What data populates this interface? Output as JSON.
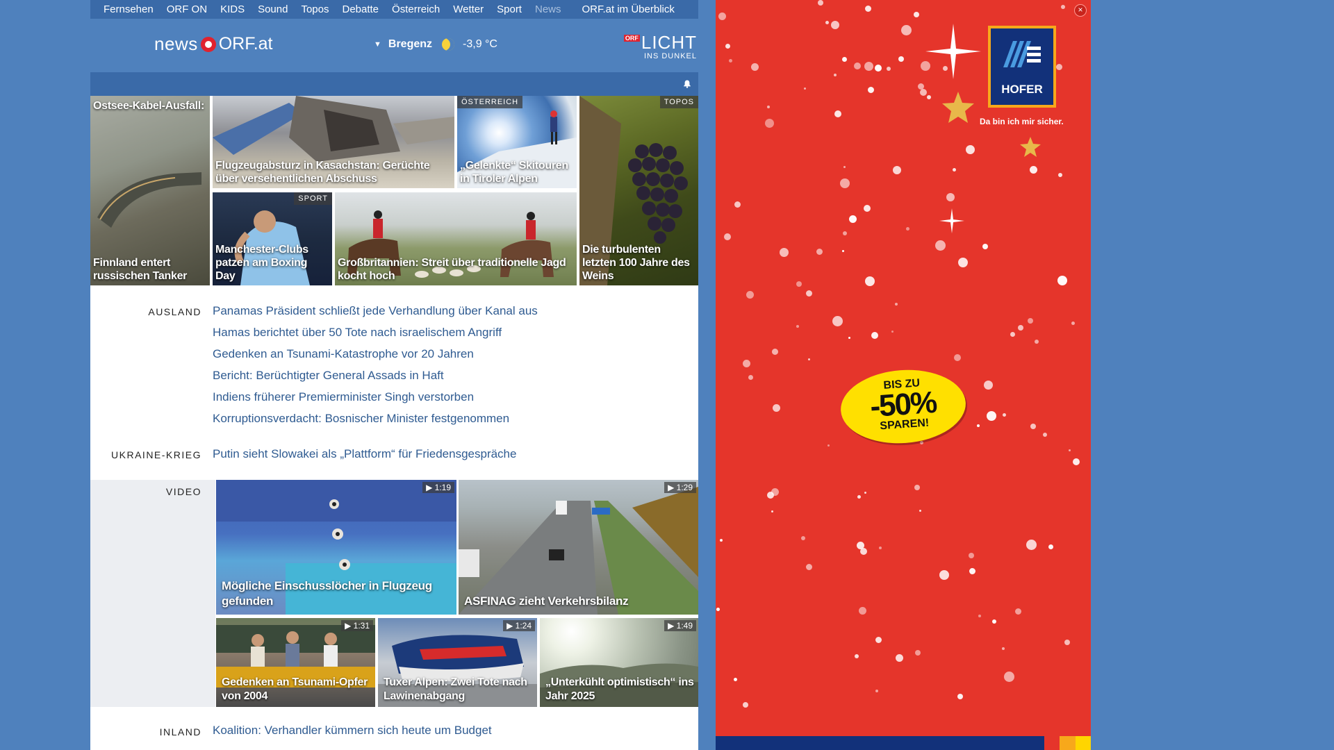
{
  "nav": {
    "items": [
      "Fernsehen",
      "ORF ON",
      "KIDS",
      "Sound",
      "Topos",
      "Debatte",
      "Österreich",
      "Wetter",
      "Sport",
      "News"
    ],
    "active": "News",
    "overview": "ORF.at im Überblick"
  },
  "header": {
    "logo_news": "news",
    "logo_orf": "ORF.at",
    "weather_city": "Bregenz",
    "weather_temp": "-3,9 °C",
    "licht_badge": "ORF",
    "licht_big": "LICHT",
    "licht_small": "INS DUNKEL"
  },
  "top_stories": [
    {
      "title_top": "Ostsee-Kabel-Ausfall:",
      "title": "Finnland entert russischen Tanker"
    },
    {
      "title": "Flugzeugabsturz in Kasachstan: Gerüchte über versehentlichen Abschuss"
    },
    {
      "tag": "ÖSTERREICH",
      "title": "„Gelenkte“ Skitouren in Tiroler Alpen"
    },
    {
      "tag": "TOPOS",
      "title": "Die turbulenten letzten 100 Jahre des Weins"
    },
    {
      "tag": "SPORT",
      "title": "Manchester-Clubs patzen am Boxing Day"
    },
    {
      "title": "Großbritannien: Streit über traditionelle Jagd kocht hoch"
    }
  ],
  "sections": {
    "ausland": {
      "label": "AUSLAND",
      "links": [
        "Panamas Präsident schließt jede Verhandlung über Kanal aus",
        "Hamas berichtet über 50 Tote nach israelischem Angriff",
        "Gedenken an Tsunami-Katastrophe vor 20 Jahren",
        "Bericht: Berüchtigter General Assads in Haft",
        "Indiens früherer Premierminister Singh verstorben",
        "Korruptionsverdacht: Bosnischer Minister festgenommen"
      ]
    },
    "ukraine": {
      "label": "UKRAINE-KRIEG",
      "links": [
        "Putin sieht Slowakei als „Plattform“ für Friedensgespräche"
      ]
    },
    "video": {
      "label": "VIDEO",
      "items": [
        {
          "title": "Mögliche Einschusslöcher in Flugzeug gefunden",
          "duration": "1:19"
        },
        {
          "title": "ASFINAG zieht Verkehrsbilanz",
          "duration": "1:29"
        },
        {
          "title": "Gedenken an Tsunami-Opfer von 2004",
          "duration": "1:31"
        },
        {
          "title": "Tuxer Alpen: Zwei Tote nach Lawinenabgang",
          "duration": "1:24"
        },
        {
          "title": "„Unterkühlt optimistisch“ ins Jahr 2025",
          "duration": "1:49"
        }
      ]
    },
    "inland": {
      "label": "INLAND",
      "links": [
        "Koalition: Verhandler kümmern sich heute um Budget"
      ]
    }
  },
  "ad": {
    "brand": "HOFER",
    "slogan": "Da bin ich mir sicher.",
    "burst_l1": "BIS ZU",
    "burst_l2": "-50%",
    "burst_l3": "SPAREN!",
    "bg_color": "#e5352b"
  }
}
